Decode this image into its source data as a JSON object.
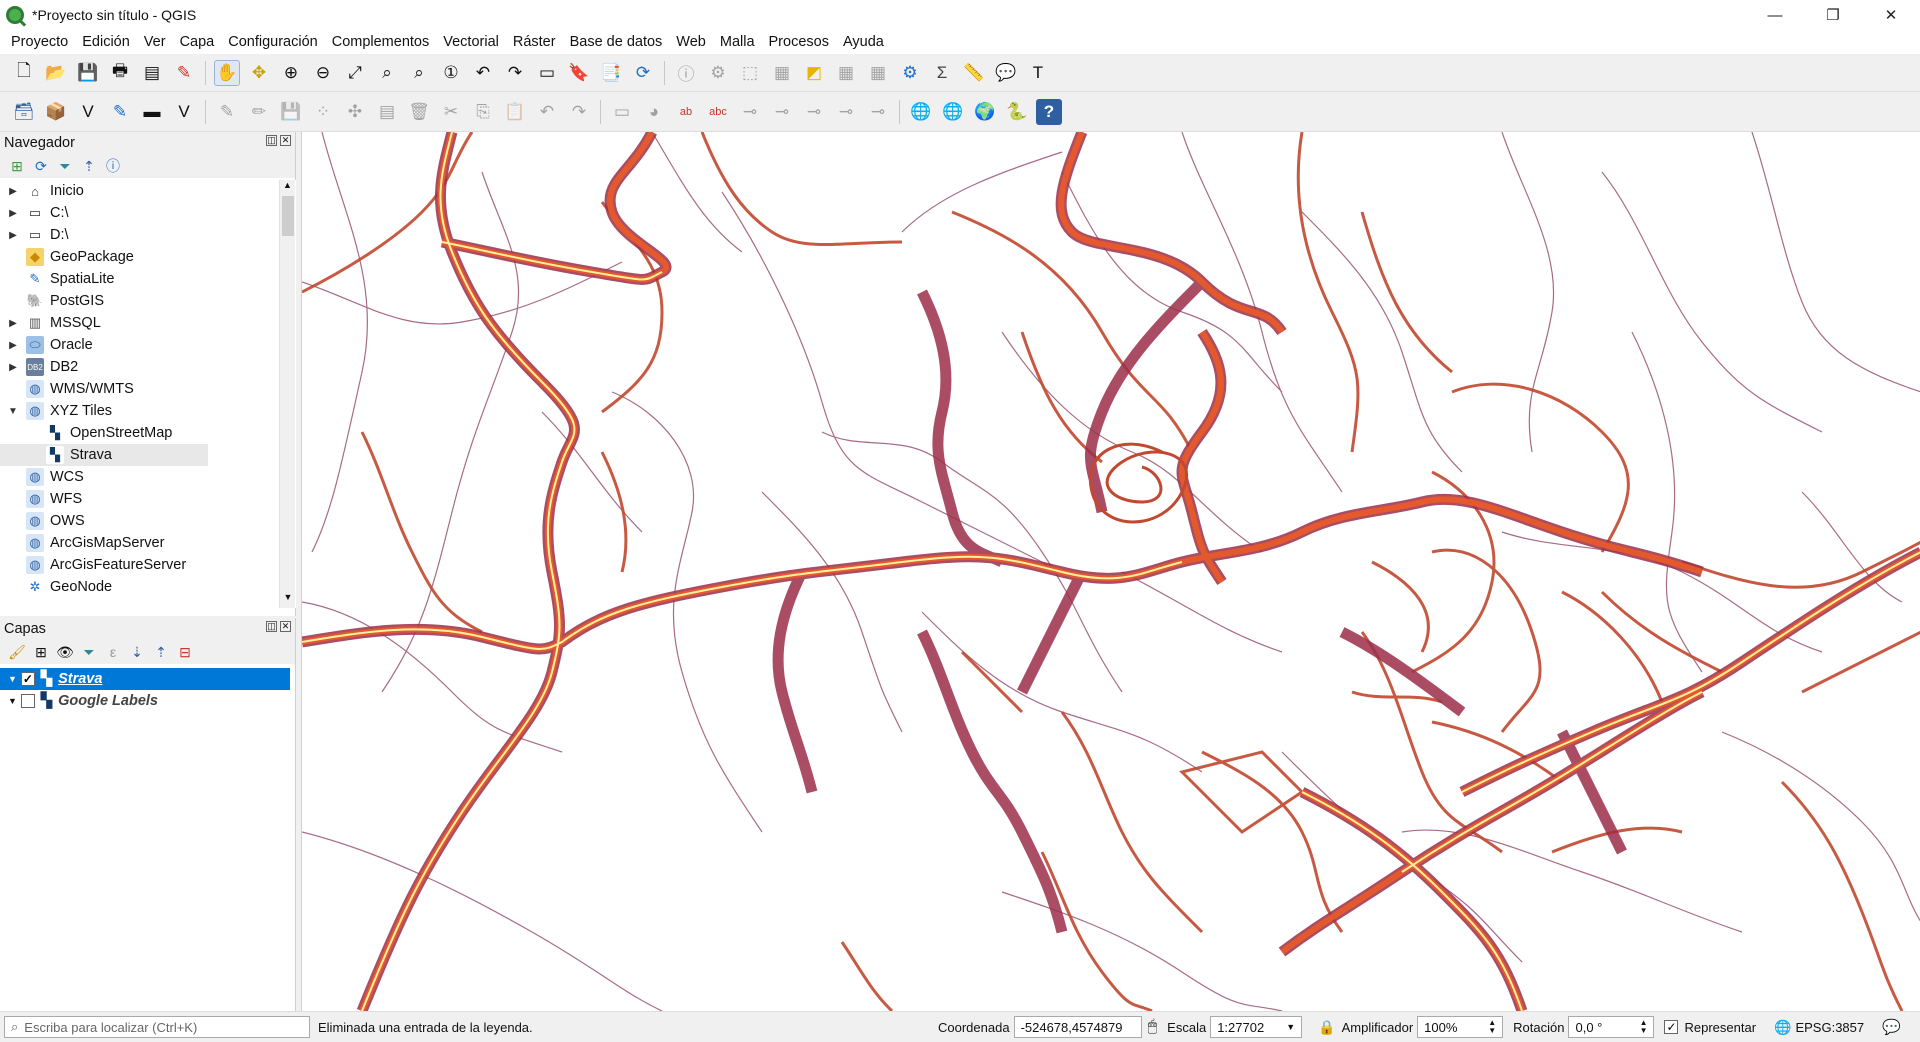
{
  "window": {
    "title": "*Proyecto sin título - QGIS",
    "minimize": "—",
    "maximize": "❐",
    "close": "✕"
  },
  "menu": [
    "Proyecto",
    "Edición",
    "Ver",
    "Capa",
    "Configuración",
    "Complementos",
    "Vectorial",
    "Ráster",
    "Base de datos",
    "Web",
    "Malla",
    "Procesos",
    "Ayuda"
  ],
  "navigator": {
    "title": "Navegador",
    "items": [
      {
        "label": "Inicio",
        "icon": "home-icon",
        "expand": "▶"
      },
      {
        "label": "C:\\",
        "icon": "folder-icon",
        "expand": "▶"
      },
      {
        "label": "D:\\",
        "icon": "folder-icon",
        "expand": "▶"
      },
      {
        "label": "GeoPackage",
        "icon": "geopackage-icon",
        "expand": ""
      },
      {
        "label": "SpatiaLite",
        "icon": "spatialite-icon",
        "expand": ""
      },
      {
        "label": "PostGIS",
        "icon": "postgis-icon",
        "expand": ""
      },
      {
        "label": "MSSQL",
        "icon": "mssql-icon",
        "expand": "▶"
      },
      {
        "label": "Oracle",
        "icon": "oracle-icon",
        "expand": "▶"
      },
      {
        "label": "DB2",
        "icon": "db2-icon",
        "expand": "▶"
      },
      {
        "label": "WMS/WMTS",
        "icon": "globe-icon",
        "expand": ""
      },
      {
        "label": "XYZ Tiles",
        "icon": "globe-icon",
        "expand": "▼"
      },
      {
        "label": "OpenStreetMap",
        "icon": "tiles-icon",
        "expand": "",
        "indent": true
      },
      {
        "label": "Strava",
        "icon": "tiles-icon",
        "expand": "",
        "indent": true,
        "selected": true
      },
      {
        "label": "WCS",
        "icon": "globe-icon",
        "expand": ""
      },
      {
        "label": "WFS",
        "icon": "globe-icon",
        "expand": ""
      },
      {
        "label": "OWS",
        "icon": "globe-icon",
        "expand": ""
      },
      {
        "label": "ArcGisMapServer",
        "icon": "globe-icon",
        "expand": ""
      },
      {
        "label": "ArcGisFeatureServer",
        "icon": "globe-icon",
        "expand": ""
      },
      {
        "label": "GeoNode",
        "icon": "geonode-icon",
        "expand": ""
      }
    ]
  },
  "layers": {
    "title": "Capas",
    "items": [
      {
        "label": "Strava",
        "checked": true,
        "selected": true
      },
      {
        "label": "Google Labels",
        "checked": false,
        "selected": false
      }
    ]
  },
  "status": {
    "search_placeholder": "Escriba para localizar (Ctrl+K)",
    "message": "Eliminada una entrada de la leyenda.",
    "coord_label": "Coordenada",
    "coord_value": "-524678,4574879",
    "scale_label": "Escala",
    "scale_value": "1:27702",
    "magnifier_label": "Amplificador",
    "magnifier_value": "100%",
    "rotation_label": "Rotación",
    "rotation_value": "0,0 °",
    "render_label": "Representar",
    "crs": "EPSG:3857"
  },
  "colors": {
    "heat_low": "#7b2d4f",
    "heat_mid": "#d9532b",
    "heat_high": "#fff3a8",
    "selection": "#0078d7"
  }
}
